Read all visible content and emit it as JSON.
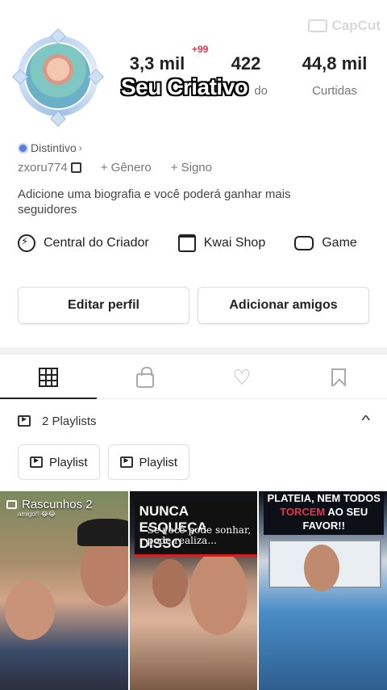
{
  "watermark": "CapCut",
  "profile": {
    "stats": [
      {
        "value": "3,3 mil",
        "label": ""
      },
      {
        "value": "422",
        "label": "do"
      },
      {
        "value": "44,8 mil",
        "label": "Curtidas"
      }
    ],
    "notification_badge": "+99",
    "overlay_title": "Seu Criativo",
    "badge_label": "Distintivo",
    "username": "zxoru774",
    "gender_chip": "+ Gênero",
    "sign_chip": "+ Signo",
    "bio": "Adicione uma biografia e você poderá ganhar mais seguidores"
  },
  "tools": [
    {
      "label": "Central do Criador",
      "icon": "bolt-circle-icon"
    },
    {
      "label": "Kwai Shop",
      "icon": "shopping-bag-icon"
    },
    {
      "label": "Game",
      "icon": "gamepad-icon"
    }
  ],
  "buttons": {
    "edit_profile": "Editar perfil",
    "add_friends": "Adicionar amigos"
  },
  "tabs": [
    "grid-icon",
    "lock-icon",
    "heart-icon",
    "bookmark-icon"
  ],
  "playlists": {
    "header": "2 Playlists",
    "items": [
      "Playlist",
      "Playlist"
    ]
  },
  "videos": [
    {
      "label": "Rascunhos 2",
      "small_text": "amigo!! 😂😂"
    },
    {
      "banner": "NUNCA ESQUEÇA DISSO",
      "sub": "Se você pode sonhar, pode realiza..."
    },
    {
      "top_line1": "PLATEIA, NEM TODOS",
      "top_red": "TORCEM",
      "top_line2": " AO SEU FAVOR!!"
    }
  ]
}
